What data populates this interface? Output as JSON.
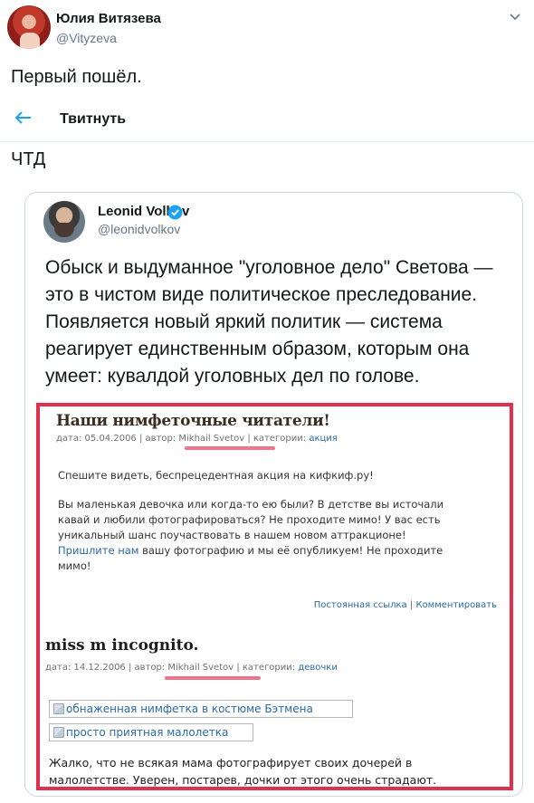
{
  "author": {
    "name": "Юлия Витязева",
    "handle": "@Vityzeva"
  },
  "tweet": {
    "text": "Первый пошёл."
  },
  "retweet_header": {
    "title": "Твитнуть"
  },
  "reply_text": "ЧТД",
  "quoted": {
    "name": "Leonid Volkov",
    "handle": "@leonidvolkov",
    "text_lines": [
      "Обыск и выдуманное \"уголовное дело\" Светова —",
      "это в чистом виде политическое преследование.",
      "Появляется новый яркий политик — система",
      "реагирует единственным образом, которым она",
      "умеет: кувалдой уголовных дел по голове."
    ]
  },
  "screenshot": {
    "post1": {
      "title": "Наши нимфеточные читатели!",
      "meta_prefix": "дата: 05.04.2006 | автор: Mikhail Svetov | категории:",
      "meta_category": "акция",
      "para1": "Спешите видеть, беспрецедентная акция на кифкиф.ру!",
      "para2_lines": [
        "Вы маленькая девочка или когда-то ею были? В детстве вы источали",
        "кавай и любили фотографироваться? Не проходите мимо! У вас есть",
        "уникальный шанс поучаствовать в нашем новом аттракционе!"
      ],
      "para2_link": "Пришлите нам",
      "para2_after_link": " вашу фотографию и мы её опубликуем! Не проходите",
      "para2_last": "мимо!",
      "permalink": "Постоянная ссылка",
      "sep": " | ",
      "comment": "Комментировать"
    },
    "post2": {
      "title": "miss m incognito.",
      "meta_prefix": "дата: 14.12.2006 | автор: Mikhail Svetov | категории:",
      "meta_category": "девочки",
      "image1_alt": "обнаженная нимфетка в костюме Бэтмена",
      "image2_alt": "просто приятная малолетка",
      "para_lines": [
        "Жалко, что не всякая мама фотографирует своих дочерей в",
        "малолетстве. Уверен, постарев, дочки от этого очень страдают."
      ]
    }
  },
  "colors": {
    "twitter_blue": "#1da1f2",
    "highlight_border": "#e0304e",
    "underline_mark": "#f0748a"
  }
}
